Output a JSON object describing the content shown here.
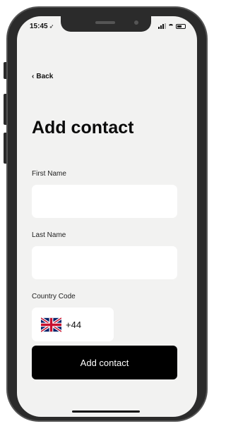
{
  "status_bar": {
    "time": "15:45",
    "location_icon": "location-arrow-icon",
    "signal_icon": "cellular-signal-icon",
    "wifi_icon": "wifi-icon",
    "battery_icon": "battery-icon"
  },
  "nav": {
    "back_label": "Back",
    "back_icon": "chevron-left-icon"
  },
  "page": {
    "title": "Add contact"
  },
  "form": {
    "first_name_label": "First Name",
    "first_name_value": "",
    "last_name_label": "Last Name",
    "last_name_value": "",
    "country_code_label": "Country Code",
    "country_flag": "uk-flag-icon",
    "country_code_value": "+44",
    "submit_label": "Add contact"
  },
  "colors": {
    "screen_bg": "#f2f2f1",
    "field_bg": "#ffffff",
    "button_bg": "#000000",
    "button_text": "#ffffff",
    "device_frame": "#2b2b2b"
  }
}
